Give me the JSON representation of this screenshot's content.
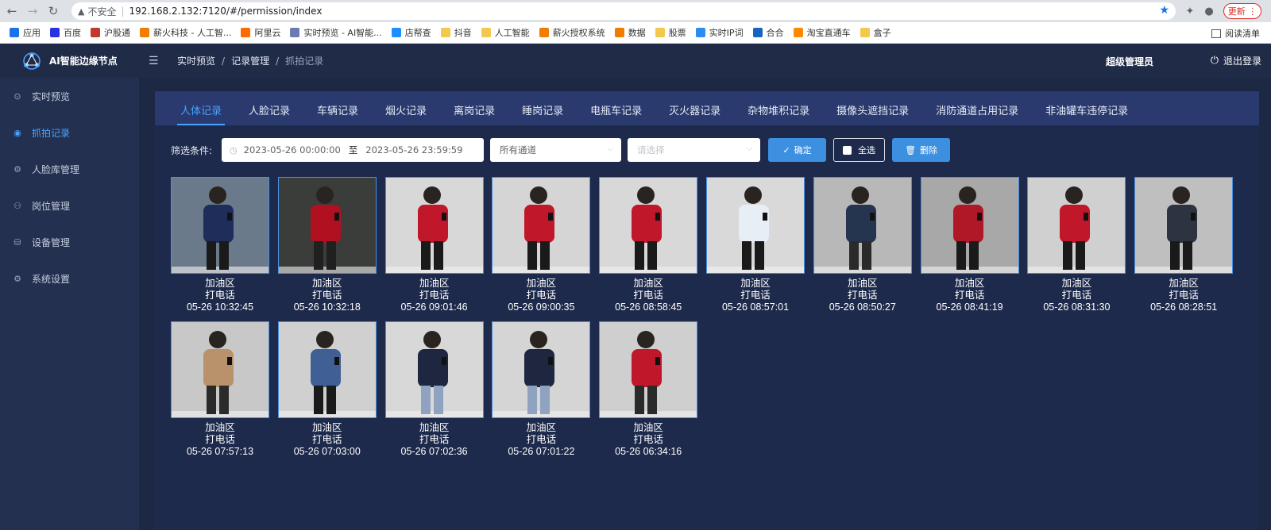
{
  "browser": {
    "url": "192.168.2.132:7120/#/permission/index",
    "insecure_label": "不安全",
    "update_label": "更新",
    "bookmarks": [
      {
        "label": "应用",
        "color": "#1a73e8"
      },
      {
        "label": "百度",
        "color": "#2932e1"
      },
      {
        "label": "沪股通",
        "color": "#c0392b"
      },
      {
        "label": "薪火科技 - 人工智...",
        "color": "#f07c00"
      },
      {
        "label": "阿里云",
        "color": "#ff6a00"
      },
      {
        "label": "实时预览 - AI智能...",
        "color": "#6a7bb2"
      },
      {
        "label": "店帮查",
        "color": "#1890ff"
      },
      {
        "label": "抖音",
        "color": "#f2c94c"
      },
      {
        "label": "人工智能",
        "color": "#f2c94c"
      },
      {
        "label": "薪火授权系统",
        "color": "#f07c00"
      },
      {
        "label": "数据",
        "color": "#f07c00"
      },
      {
        "label": "股票",
        "color": "#f2c94c"
      },
      {
        "label": "实时IP词",
        "color": "#2d8cf0"
      },
      {
        "label": "合合",
        "color": "#1565c0"
      },
      {
        "label": "淘宝直通车",
        "color": "#ff8a00"
      },
      {
        "label": "盒子",
        "color": "#f2c94c"
      }
    ],
    "reading_list": "阅读清单"
  },
  "app": {
    "brand": "AI智能边缘节点",
    "sidebar": [
      {
        "label": "实时预览",
        "icon": "play-circle-icon",
        "glyph": "⊙"
      },
      {
        "label": "抓拍记录",
        "icon": "camera-icon",
        "glyph": "◉"
      },
      {
        "label": "人脸库管理",
        "icon": "gear-icon",
        "glyph": "⚙"
      },
      {
        "label": "岗位管理",
        "icon": "users-icon",
        "glyph": "⚇"
      },
      {
        "label": "设备管理",
        "icon": "device-icon",
        "glyph": "⛁"
      },
      {
        "label": "系统设置",
        "icon": "settings-icon",
        "glyph": "⚙"
      }
    ],
    "active_sidebar": 1,
    "breadcrumb": [
      "实时预览",
      "记录管理",
      "抓拍记录"
    ],
    "user": "超级管理员",
    "logout": "退出登录",
    "accent_color": "#4aa3ff"
  },
  "tabs": [
    "人体记录",
    "人脸记录",
    "车辆记录",
    "烟火记录",
    "离岗记录",
    "睡岗记录",
    "电瓶车记录",
    "灭火器记录",
    "杂物堆积记录",
    "摄像头遮挡记录",
    "消防通道占用记录",
    "非油罐车违停记录"
  ],
  "active_tab": 0,
  "filter": {
    "label": "筛选条件:",
    "start": "2023-05-26 00:00:00",
    "separator": "至",
    "end": "2023-05-26 23:59:59",
    "channel": "所有通道",
    "select_placeholder": "请选择",
    "confirm": "确定",
    "select_all": "全选",
    "delete": "删除"
  },
  "records": [
    {
      "area": "加油区",
      "event": "打电话",
      "time": "05-26 10:32:45",
      "bg": "#6b7a8a",
      "body": "#1f2d5a",
      "legs": "#1a1a1a"
    },
    {
      "area": "加油区",
      "event": "打电话",
      "time": "05-26 10:32:18",
      "bg": "#3a3d3a",
      "body": "#b01020",
      "legs": "#202020"
    },
    {
      "area": "加油区",
      "event": "打电话",
      "time": "05-26 09:01:46",
      "bg": "#d8d8d8",
      "body": "#c0182a",
      "legs": "#1a1a1a"
    },
    {
      "area": "加油区",
      "event": "打电话",
      "time": "05-26 09:00:35",
      "bg": "#d5d5d5",
      "body": "#c0182a",
      "legs": "#1a1a1a"
    },
    {
      "area": "加油区",
      "event": "打电话",
      "time": "05-26 08:58:45",
      "bg": "#d8d8d8",
      "body": "#c0182a",
      "legs": "#1a1a1a"
    },
    {
      "area": "加油区",
      "event": "打电话",
      "time": "05-26 08:57:01",
      "bg": "#d9d9d9",
      "body": "#e8eef5",
      "legs": "#1a1a1a"
    },
    {
      "area": "加油区",
      "event": "打电话",
      "time": "05-26 08:50:27",
      "bg": "#b8b8b8",
      "body": "#253550",
      "legs": "#2a2a2a"
    },
    {
      "area": "加油区",
      "event": "打电话",
      "time": "05-26 08:41:19",
      "bg": "#a8a8a8",
      "body": "#b01828",
      "legs": "#1a1a1a"
    },
    {
      "area": "加油区",
      "event": "打电话",
      "time": "05-26 08:31:30",
      "bg": "#d0d0d0",
      "body": "#c0182a",
      "legs": "#1a1a1a"
    },
    {
      "area": "加油区",
      "event": "打电话",
      "time": "05-26 08:28:51",
      "bg": "#bfbfbf",
      "body": "#2d3340",
      "legs": "#1a1a1a"
    },
    {
      "area": "加油区",
      "event": "打电话",
      "time": "05-26 07:57:13",
      "bg": "#c8c8c8",
      "body": "#b9916a",
      "legs": "#2a2a2a"
    },
    {
      "area": "加油区",
      "event": "打电话",
      "time": "05-26 07:03:00",
      "bg": "#d0d0d0",
      "body": "#3f5f95",
      "legs": "#1a1a1a"
    },
    {
      "area": "加油区",
      "event": "打电话",
      "time": "05-26 07:02:36",
      "bg": "#d8d8d8",
      "body": "#1e2640",
      "legs": "#8fa3c0"
    },
    {
      "area": "加油区",
      "event": "打电话",
      "time": "05-26 07:01:22",
      "bg": "#d5d5d5",
      "body": "#1e2640",
      "legs": "#8fa3c0"
    },
    {
      "area": "加油区",
      "event": "打电话",
      "time": "05-26 06:34:16",
      "bg": "#cfcfcf",
      "body": "#c0182a",
      "legs": "#2a2a2a"
    }
  ]
}
